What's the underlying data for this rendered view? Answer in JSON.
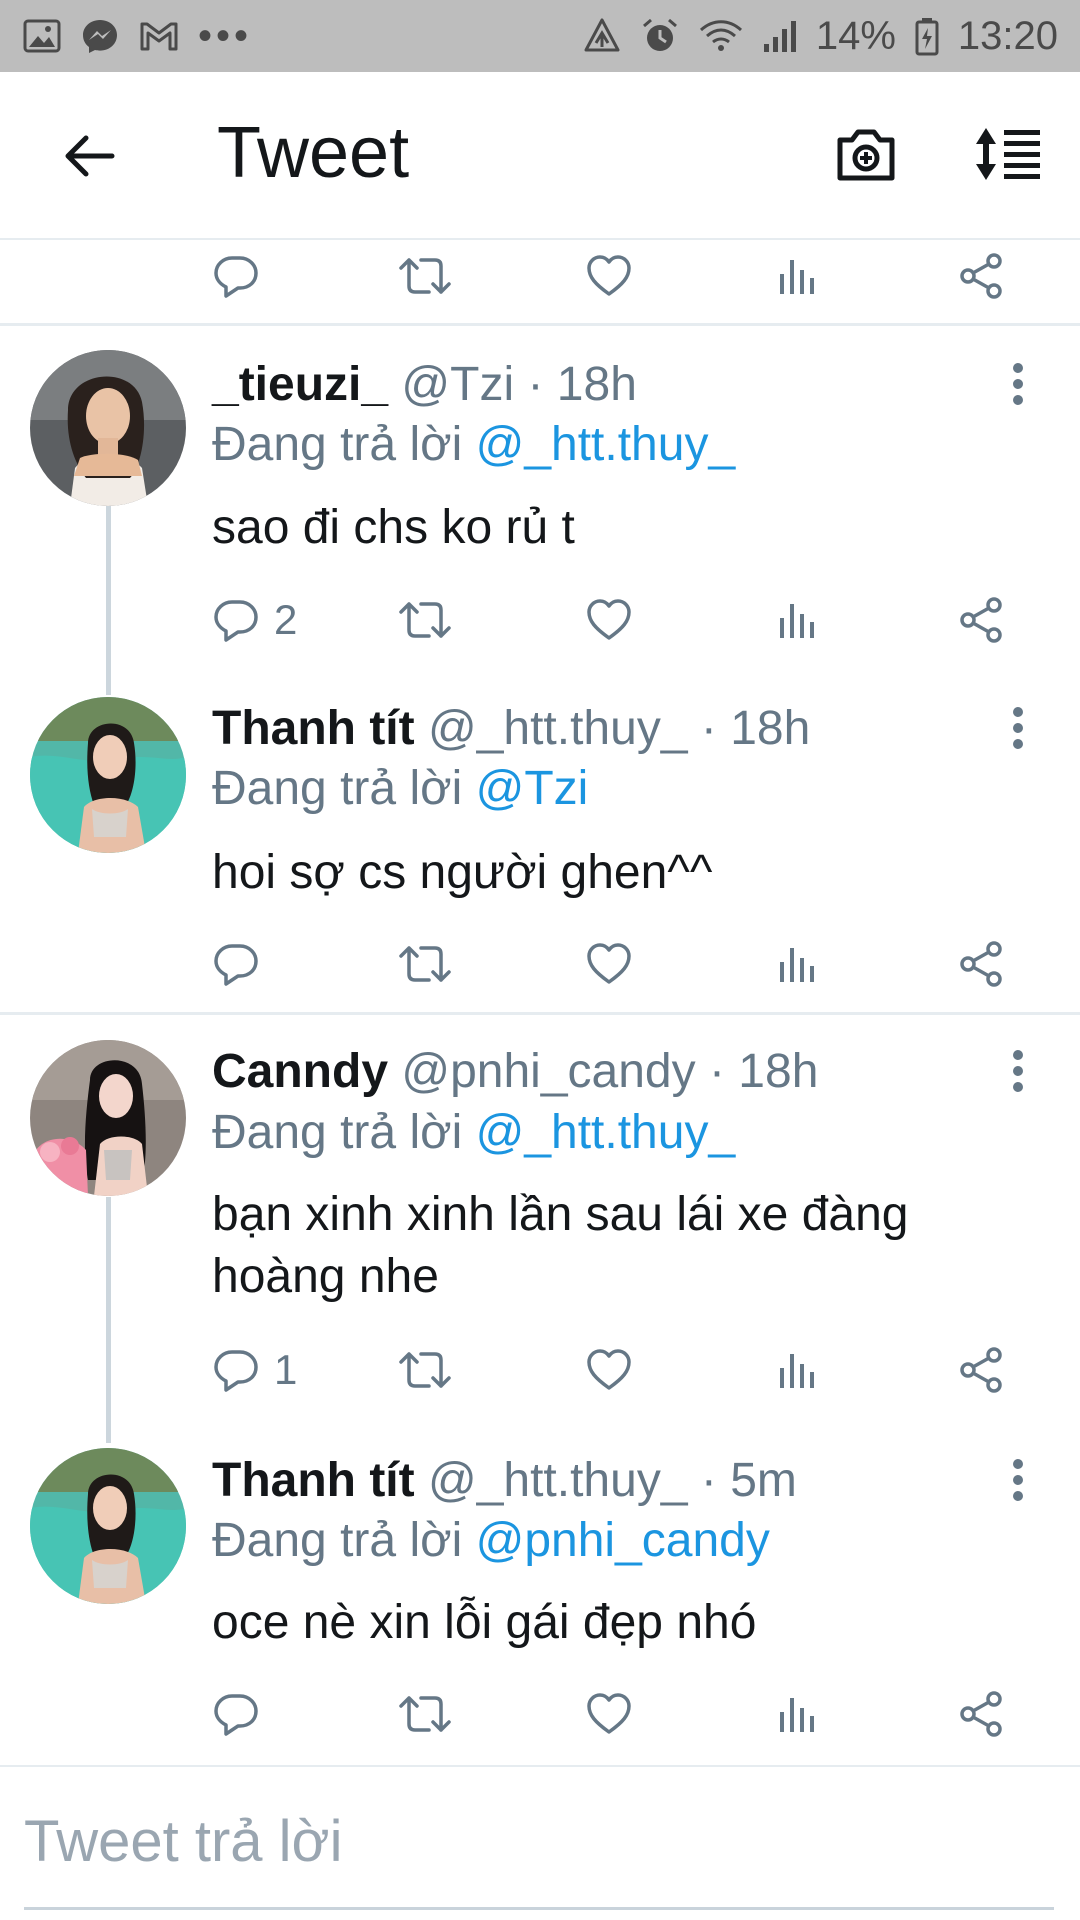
{
  "status_bar": {
    "battery_percent": "14%",
    "time": "13:20",
    "left_icons": [
      "gallery-icon",
      "messenger-icon",
      "gmail-icon",
      "more-dots-icon"
    ],
    "right_icons": [
      "data-saver-icon",
      "alarm-icon",
      "wifi-icon",
      "signal-icon",
      "battery-icon"
    ]
  },
  "app_bar": {
    "title": "Tweet",
    "icons": [
      "back-arrow-icon",
      "camera-add-icon",
      "sort-icon"
    ]
  },
  "action_labels": [
    "reply-icon",
    "retweet-icon",
    "like-icon",
    "analytics-icon",
    "share-icon"
  ],
  "tweets": [
    {
      "name": "_tieuzi_",
      "handle": "@Tzi",
      "dot": "·",
      "time": "18h",
      "reply_prefix": "Đang trả lời",
      "reply_mention": "@_htt.thuy_",
      "text": "sao đi chs ko rủ t",
      "reply_count": "2"
    },
    {
      "name": "Thanh tít",
      "handle": "@_htt.thuy_",
      "dot": "·",
      "time": "18h",
      "reply_prefix": "Đang trả lời",
      "reply_mention": "@Tzi",
      "text": "hoi sợ cs người ghen^^",
      "reply_count": ""
    },
    {
      "name": "Canndy",
      "handle": "@pnhi_candy",
      "dot": "·",
      "time": "18h",
      "reply_prefix": "Đang trả lời",
      "reply_mention": "@_htt.thuy_",
      "text": "bạn xinh xinh lần sau lái xe đàng hoàng nhe",
      "reply_count": "1"
    },
    {
      "name": "Thanh tít",
      "handle": "@_htt.thuy_",
      "dot": "·",
      "time": "5m",
      "reply_prefix": "Đang trả lời",
      "reply_mention": "@pnhi_candy",
      "text": "oce nè xin lỗi gái đẹp nhó",
      "reply_count": ""
    }
  ],
  "composer": {
    "placeholder": "Tweet trả lời"
  },
  "colors": {
    "status_bar_bg": "#bdbdbd",
    "text_primary": "#14171a",
    "text_secondary": "#657786",
    "link": "#1b95e0",
    "divider": "#e6ecf0"
  }
}
